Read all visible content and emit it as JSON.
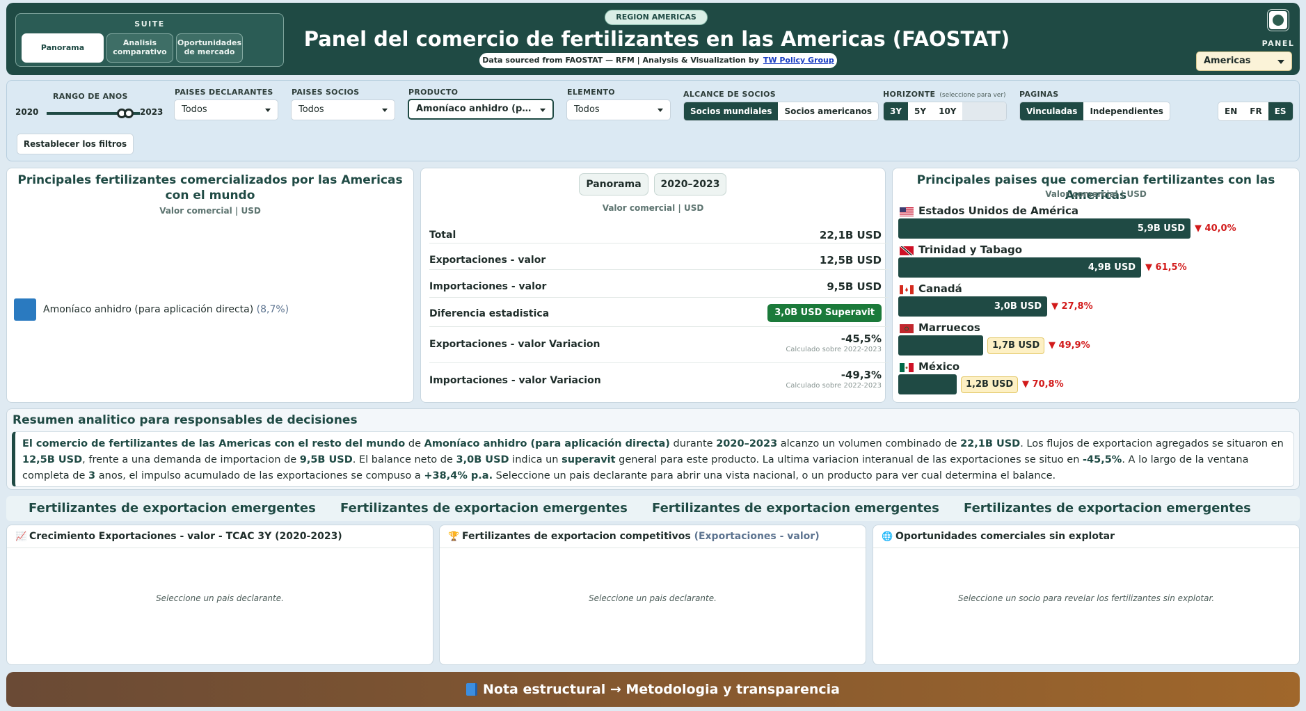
{
  "header": {
    "suite_label": "SUITE",
    "suite_tabs": [
      "Panorama",
      "Analisis comparativo",
      "Oportunidades de mercado"
    ],
    "region_badge": "REGION AMERICAS",
    "title": "Panel del comercio de fertilizantes en las Americas (FAOSTAT)",
    "source_text": "Data sourced from FAOSTAT — RFM | Analysis & Visualization by",
    "source_link": "TW Policy Group",
    "panel_label": "PANEL",
    "panel_value": "Americas"
  },
  "filters": {
    "year_range_label": "RANGO DE ANOS",
    "year_start": "2020",
    "year_end": "2023",
    "reporters_label": "PAISES DECLARANTES",
    "reporters_value": "Todos",
    "partners_label": "PAISES SOCIOS",
    "partners_value": "Todos",
    "product_label": "PRODUCTO",
    "product_value": "Amoníaco anhidro (para aplicación directa)",
    "element_label": "ELEMENTO",
    "element_value": "Todos",
    "scope_label": "ALCANCE DE SOCIOS",
    "scope_options": [
      "Socios mundiales",
      "Socios americanos"
    ],
    "horizon_label": "HORIZONTE",
    "horizon_hint": "(seleccione para ver)",
    "horizon_options": [
      "3Y",
      "5Y",
      "10Y"
    ],
    "pages_label": "PAGINAS",
    "pages_options": [
      "Vinculadas",
      "Independientes"
    ],
    "languages": [
      "EN",
      "FR",
      "ES"
    ],
    "reset_label": "Restablecer los filtros"
  },
  "top_products": {
    "title": "Principales fertilizantes comercializados por las Americas con el mundo",
    "subtitle": "Valor comercial | USD",
    "legend_label": "Amoníaco anhidro (para aplicación directa)",
    "legend_pct": "(8,7%)",
    "legend_color": "#2a7ac0"
  },
  "kpi": {
    "tabs": [
      "Panorama",
      "2020–2023"
    ],
    "subtitle": "Valor comercial | USD",
    "rows": [
      {
        "label": "Total",
        "value": "22,1B USD"
      },
      {
        "label": "Exportaciones - valor",
        "value": "12,5B USD"
      },
      {
        "label": "Importaciones - valor",
        "value": "9,5B USD"
      },
      {
        "label": "Diferencia estadistica",
        "value": "3,0B USD Superavit"
      },
      {
        "label": "Exportaciones - valor Variacion",
        "value": "-45,5%",
        "note": "Calculado sobre 2022-2023"
      },
      {
        "label": "Importaciones - valor Variacion",
        "value": "-49,3%",
        "note": "Calculado sobre 2022-2023"
      }
    ]
  },
  "top_countries": {
    "title": "Principales paises que comercian fertilizantes con las Americas",
    "subtitle": "Valor comercial | USD",
    "items": [
      {
        "name": "Estados Unidos de América",
        "value": "5,9B USD",
        "change": "▼ 40,0%",
        "fraction": 1.0
      },
      {
        "name": "Trinidad y Tabago",
        "value": "4,9B USD",
        "change": "▼ 61,5%",
        "fraction": 0.83
      },
      {
        "name": "Canadá",
        "value": "3,0B USD",
        "change": "▼ 27,8%",
        "fraction": 0.51
      },
      {
        "name": "Marruecos",
        "value": "1,7B USD",
        "change": "▼ 49,9%",
        "fraction": 0.29
      },
      {
        "name": "México",
        "value": "1,2B USD",
        "change": "▼ 70,8%",
        "fraction": 0.2
      }
    ]
  },
  "summary": {
    "title": "Resumen analitico para responsables de decisiones",
    "p1": "El comercio de fertilizantes de las Americas con el resto del mundo",
    "t1": " de ",
    "p2": "Amoníaco anhidro (para aplicación directa)",
    "t2": " durante ",
    "p3": "2020–2023",
    "t3": " alcanzo un volumen combinado de ",
    "p4": "22,1B USD",
    "t4": ". Los flujos de exportacion agregados se situaron en ",
    "p5": "12,5B USD",
    "t5": ", frente a una demanda de importacion de ",
    "p6": "9,5B USD",
    "t6": ". El balance neto de ",
    "p7": "3,0B USD",
    "t7": " indica un ",
    "p8": "superavit",
    "t8": " general para este producto. La ultima variacion interanual de las exportaciones se situo en ",
    "p9": "-45,5%",
    "t9": ". A lo largo de la ventana completa de ",
    "p10": "3",
    "t10": " anos, el impulso acumulado de las exportaciones se compuso a ",
    "p11": "+38,4% p.a.",
    "t11": " Seleccione un pais declarante para abrir una vista nacional, o un producto para ver cual determina el balance."
  },
  "emerging": {
    "items": [
      "Fertilizantes de exportacion emergentes",
      "Fertilizantes de exportacion emergentes",
      "Fertilizantes de exportacion emergentes",
      "Fertilizantes de exportacion emergentes"
    ]
  },
  "panels": [
    {
      "icon": "chart-up-icon",
      "title": "Crecimiento Exportaciones - valor - TCAC 3Y (2020-2023)",
      "muted": "",
      "message": "Seleccione un pais declarante."
    },
    {
      "icon": "trophy-icon",
      "title": "Fertilizantes de exportacion competitivos",
      "muted": "(Exportaciones - valor)",
      "message": "Seleccione un pais declarante."
    },
    {
      "icon": "globe-icon",
      "title": "Oportunidades comerciales sin explotar",
      "muted": "",
      "message": "Seleccione un socio para revelar los fertilizantes sin explotar."
    }
  ],
  "footer": {
    "label": "Nota estructural → Metodologia y transparencia"
  },
  "colors": {
    "primary": "#1f4a44",
    "accent_negative": "#d21a1a",
    "surplus": "#1b7a3a",
    "highlight": "#fdf0c4"
  }
}
